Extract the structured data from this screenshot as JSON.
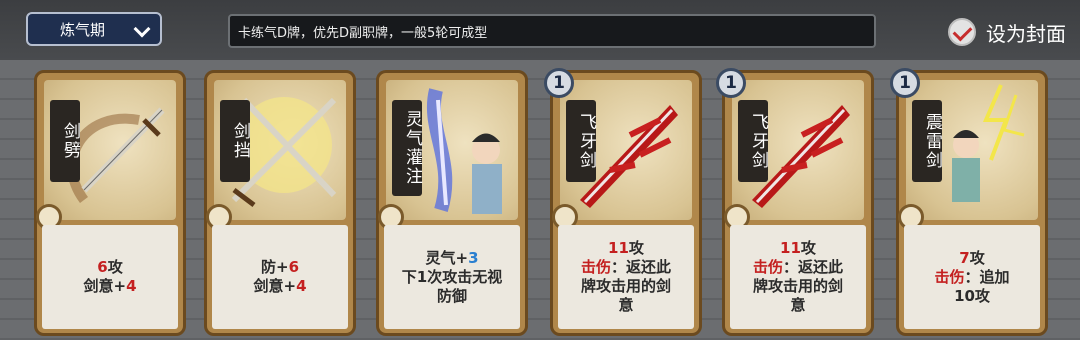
{
  "header": {
    "realm": "炼气期",
    "note": "卡练气D牌，优先D副职牌，一般5轮可成型",
    "cover_label": "设为封面"
  },
  "cards": [
    {
      "name": "剑劈",
      "level": "",
      "lines": [
        {
          "v": "6",
          "t": "攻"
        },
        {
          "k": "剑意+",
          "v": "4"
        }
      ]
    },
    {
      "name": "剑挡",
      "level": "",
      "lines": [
        {
          "k": "防+",
          "v": "6"
        },
        {
          "k": "剑意+",
          "v": "4"
        }
      ]
    },
    {
      "name": "灵气灌注",
      "level": "",
      "lines": [
        {
          "k": "灵气+",
          "v": "3"
        },
        {
          "t": "下1次攻击无视"
        },
        {
          "t": "防御"
        }
      ]
    },
    {
      "name": "飞牙剑",
      "level": "1",
      "lines": [
        {
          "v": "11",
          "t": "攻"
        },
        {
          "kw": "击伤",
          "t": "：返还此"
        },
        {
          "t": "牌攻击用的剑"
        },
        {
          "t": "意"
        }
      ]
    },
    {
      "name": "飞牙剑",
      "level": "1",
      "lines": [
        {
          "v": "11",
          "t": "攻"
        },
        {
          "kw": "击伤",
          "t": "：返还此"
        },
        {
          "t": "牌攻击用的剑"
        },
        {
          "t": "意"
        }
      ]
    },
    {
      "name": "震雷剑",
      "level": "1",
      "lines": [
        {
          "v": "7",
          "t": "攻"
        },
        {
          "kw": "击伤",
          "t": "：追加"
        },
        {
          "t": "10攻"
        }
      ]
    }
  ]
}
